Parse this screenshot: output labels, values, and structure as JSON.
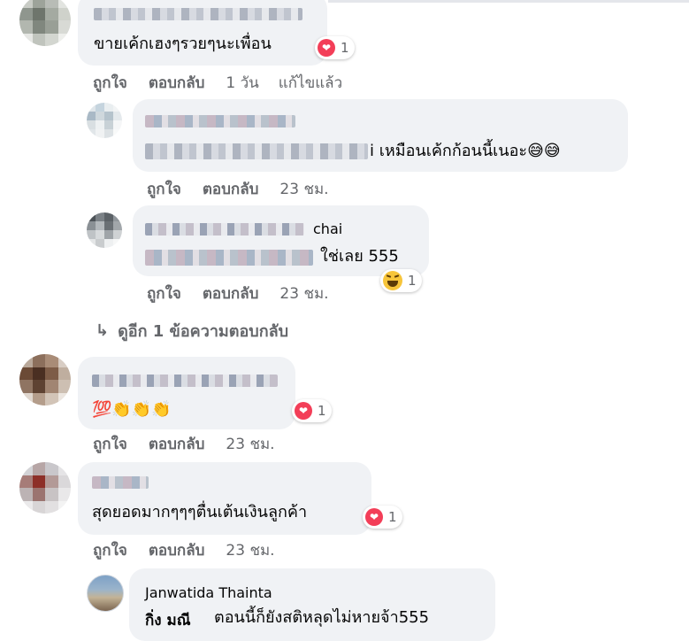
{
  "comments": [
    {
      "text": "ขายเค้กเฮงๆรวยๆนะเพื่อน",
      "reaction_count": "1",
      "actions": {
        "like": "ถูกใจ",
        "reply": "ตอบกลับ",
        "time": "1 วัน",
        "edited": "แก้ไขแล้ว"
      }
    },
    {
      "text": "i เหมือนเค้กก้อนนี้เนอะ😅😅",
      "actions": {
        "like": "ถูกใจ",
        "reply": "ตอบกลับ",
        "time": "23 ชม."
      }
    },
    {
      "name_suffix": "chai",
      "text": "ใช่เลย 555",
      "reaction_count": "1",
      "actions": {
        "like": "ถูกใจ",
        "reply": "ตอบกลับ",
        "time": "23 ชม."
      }
    },
    {
      "text": "💯👏👏👏",
      "reaction_count": "1",
      "actions": {
        "like": "ถูกใจ",
        "reply": "ตอบกลับ",
        "time": "23 ชม."
      }
    },
    {
      "text": "สุดยอดมากๆๆๆตื่นเต้นเงินลูกค้า",
      "reaction_count": "1",
      "actions": {
        "like": "ถูกใจ",
        "reply": "ตอบกลับ",
        "time": "23 ชม."
      }
    },
    {
      "name": "Janwatida Thainta",
      "tag": "กิ่ง มณี",
      "text": "ตอนนี้ก็ยังสติหลุดไม่หายจ้า555"
    }
  ],
  "view_more": {
    "arrow": "↳",
    "label": "ดูอีก 1 ข้อความตอบกลับ"
  },
  "icons": {
    "heart": "heart-reaction-icon",
    "haha": "haha-reaction-icon",
    "reply_arrow": "reply-arrow-icon"
  },
  "colors": {
    "bubble": "#f0f2f5",
    "meta_text": "#65676b",
    "heart": "#f33e58",
    "haha": "#f7c53b"
  }
}
